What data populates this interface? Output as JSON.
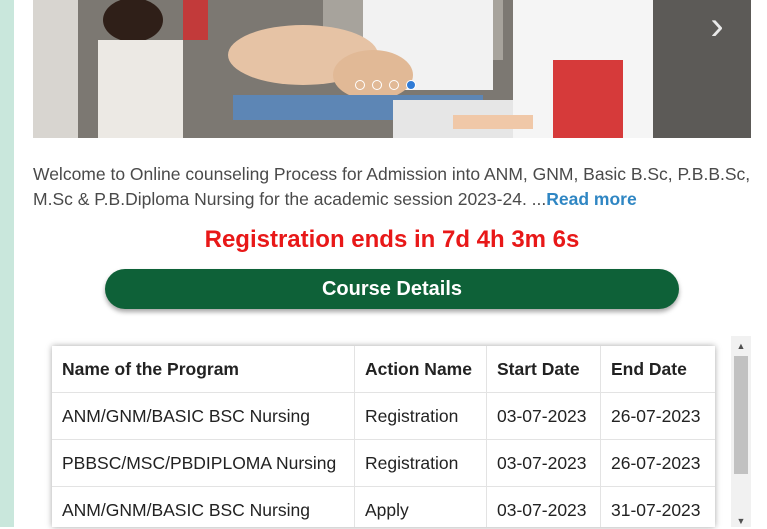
{
  "carousel": {
    "slide_count": 4,
    "active_slide": 4
  },
  "intro": {
    "text": "Welcome to Online counseling Process for Admission into ANM, GNM, Basic B.Sc, P.B.B.Sc, M.Sc & P.B.Diploma Nursing for the academic session 2023-24. ...",
    "read_more": "Read more"
  },
  "countdown": {
    "text": "Registration ends in 7d 4h 3m 6s"
  },
  "course_button": {
    "label": "Course Details"
  },
  "table": {
    "headers": [
      "Name of the Program",
      "Action Name",
      "Start Date",
      "End Date"
    ],
    "rows": [
      [
        "ANM/GNM/BASIC BSC Nursing",
        "Registration",
        "03-07-2023",
        "26-07-2023"
      ],
      [
        "PBBSC/MSC/PBDIPLOMA Nursing",
        "Registration",
        "03-07-2023",
        "26-07-2023"
      ],
      [
        "ANM/GNM/BASIC BSC Nursing",
        "Apply",
        "03-07-2023",
        "31-07-2023"
      ]
    ]
  },
  "colors": {
    "accent_green": "#0e6138",
    "countdown_red": "#e81818",
    "link_blue": "#2f86c3",
    "side_strip": "#c9e7dc"
  },
  "icons": {
    "carousel_next": "chevron-right-icon",
    "scroll_up": "triangle-up-icon",
    "scroll_down": "triangle-down-icon"
  }
}
